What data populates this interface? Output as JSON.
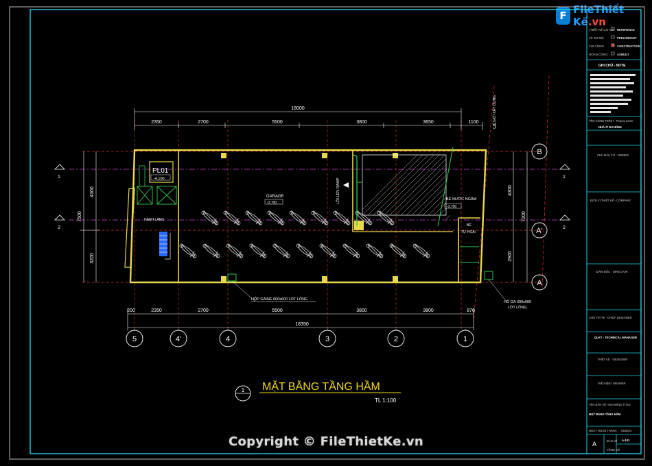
{
  "logo": {
    "mark": "F",
    "name_a": "File",
    "name_b": "Thiết Kế",
    "name_c": ".vn"
  },
  "watermark": "Copyright © FileThietKe.vn",
  "drawing": {
    "title": "MẶT BẰNG TẦNG HẦM",
    "scale": "TL 1:100",
    "symbol_number": "1",
    "overall_top": "18000",
    "overall_bottom": "18350",
    "top_dims": [
      "2350",
      "2700",
      "5500",
      "3800",
      "3650",
      "1100"
    ],
    "bottom_dims": [
      "200",
      "2350",
      "2700",
      "5500",
      "3800",
      "3800",
      "870"
    ],
    "left_dims": {
      "total": "7500",
      "upper": "4300",
      "lower": "3200"
    },
    "right_dims": {
      "total": "7200",
      "upper": "4300",
      "lower": "2900"
    },
    "grid_cols": [
      "5",
      "4'",
      "4",
      "3",
      "2",
      "1"
    ],
    "grid_rows": [
      "B",
      "A'",
      "A"
    ],
    "section_marks": [
      "1",
      "2",
      "1",
      "2"
    ],
    "rooms": {
      "pl01": "PL01",
      "pl01_level": "-4.100",
      "garage": "GARAGE",
      "garage_level": "-3.700",
      "ramp": "LỐI LÊN RAMP",
      "tank": "BỂ NƯỚC NGẦM",
      "tank_level": "-3.700",
      "septic_a": "BỂ",
      "septic_b": "TỰ HOẠI",
      "corridor": "HÀNH LANG"
    },
    "notes": {
      "boundary": "CHỈ GIỚI XÂY DỰNG",
      "shaft": "HỘP GAINE 600x600 LÓT LÔNG",
      "pit": "HỐ GA 600x600",
      "pit_sub": "LÓT LÔNG"
    }
  },
  "titleblock": {
    "phase_rows": [
      {
        "label": "THIẾT KẾ CƠ SỞ",
        "value": "REFERENCE"
      },
      {
        "label": "TK SƠ BỘ",
        "value": "PRELIMINARY"
      },
      {
        "label": "THI CÔNG",
        "value": "CONSTRUCTION"
      },
      {
        "label": "HOÀN CÔNG",
        "value": "ASBUILT"
      }
    ],
    "notes_header": "GHI CHÚ - NOTE",
    "project_label": "TÊN CÔNG TRÌNH - Project name",
    "project_name": "NHÀ Ở GIA ĐÌNH",
    "owner": "CHỦ ĐẦU TƯ - OWNER",
    "company": "ĐƠN VỊ THIẾT KẾ - COMPANY",
    "director": "GIÁM ĐỐC - DIRECTOR",
    "chief": "CHỦ TRÌ TK - CHIEF DESIGNER",
    "tech": "QLKT - TECHNICAL MANAGER",
    "designer": "THIẾT KẾ - DESIGNER",
    "drawer": "THỂ HIỆN / DRAWER",
    "drawing_title_label": "TÊN BẢN VẼ / DRAWING TITLE",
    "drawing_title": "MẶT BẰNG TẦNG HẦM",
    "date_label": "NGÀY HOÀN THÀNH",
    "date": "09/2024",
    "size": "A",
    "sheet_label": "BẢN VẼ",
    "sheet_no": "A-101",
    "total_label": "TỔNG SỐ"
  },
  "colors": {
    "frame": "#1fd1e8",
    "wall": "#e8d84a",
    "dim": "#ffffff",
    "grid_red": "#e03030",
    "grid_magenta": "#d040d0",
    "green": "#30d050",
    "blue": "#2a6cff"
  }
}
